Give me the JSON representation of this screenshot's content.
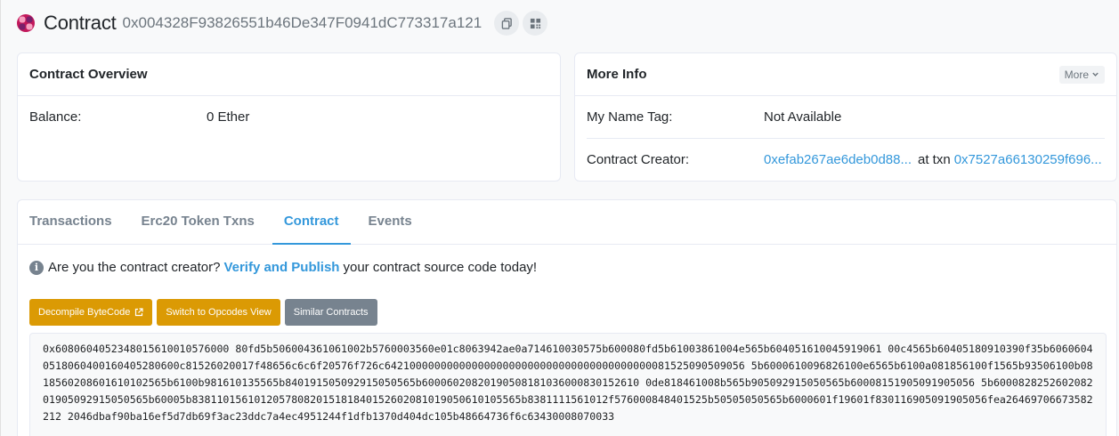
{
  "header": {
    "title": "Contract",
    "address": "0x004328F93826551b46De347F0941dC773317a121"
  },
  "overview": {
    "title": "Contract Overview",
    "balance_label": "Balance:",
    "balance_value": "0 Ether"
  },
  "more_info": {
    "title": "More Info",
    "more_button": "More",
    "name_tag_label": "My Name Tag:",
    "name_tag_value": "Not Available",
    "creator_label": "Contract Creator:",
    "creator_address": "0xefab267ae6deb0d88...",
    "at_txn": "at txn",
    "txn_hash": "0x7527a66130259f696..."
  },
  "tabs": [
    {
      "label": "Transactions"
    },
    {
      "label": "Erc20 Token Txns"
    },
    {
      "label": "Contract"
    },
    {
      "label": "Events"
    }
  ],
  "notice": {
    "prefix": "Are you the contract creator?",
    "link": "Verify and Publish",
    "suffix": "your contract source code today!"
  },
  "buttons": {
    "decompile": "Decompile ByteCode",
    "opcodes": "Switch to Opcodes View",
    "similar": "Similar Contracts"
  },
  "bytecode": "0x6080604052348015610010576000 80fd5b506004361061002b5760003560e01c8063942ae0a714610030575b600080fd5b61003861004e565b604051610045919061 00c4565b60405180910390f35b60606040518060400160405280600c81526020017f48656c6c6f20576f726c6421000000000000000000000000000000000000000081525090509056 5b6000610096826100e6565b6100a081856100f1565b93506100b0818560208601610102565b6100b981610135565b840191505092915050565b60006020820190508181036000830152610 0de818461008b565b905092915050565b60008151905091905056 5b600082825260208201905092915050565b60005b83811015610120578082015181840152602081019050610105565b8381111561012f576000848401525b50505050565b6000601f19601f830116905091905056fea26469706673582212 2046dbaf90ba16ef5d7db69f3ac23ddc7a4ec4951244f1dfb1370d404dc105b48664736f6c63430008070033"
}
